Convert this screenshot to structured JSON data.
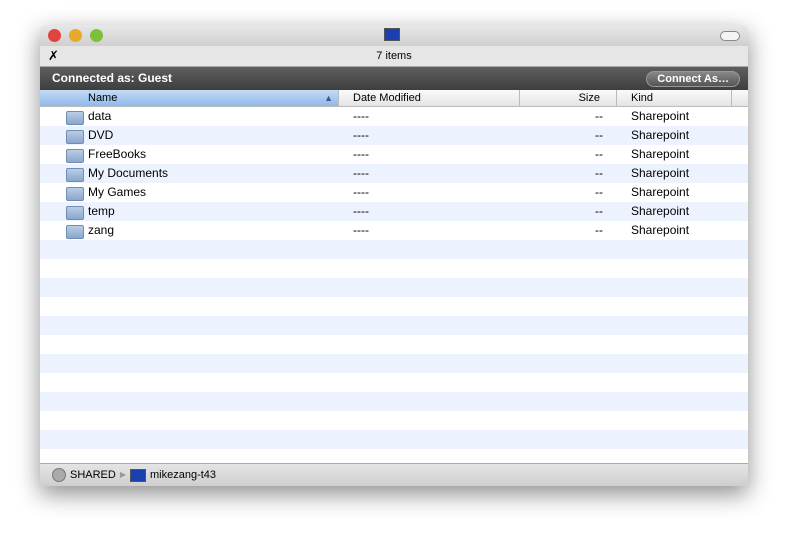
{
  "toolbar": {
    "item_count": "7 items"
  },
  "connection": {
    "label": "Connected as: Guest",
    "button": "Connect As…"
  },
  "columns": [
    "Name",
    "Date Modified",
    "Size",
    "Kind"
  ],
  "rows": [
    {
      "name": "data",
      "date": "----",
      "size": "--",
      "kind": "Sharepoint"
    },
    {
      "name": "DVD",
      "date": "----",
      "size": "--",
      "kind": "Sharepoint"
    },
    {
      "name": "FreeBooks",
      "date": "----",
      "size": "--",
      "kind": "Sharepoint"
    },
    {
      "name": "My Documents",
      "date": "----",
      "size": "--",
      "kind": "Sharepoint"
    },
    {
      "name": "My Games",
      "date": "----",
      "size": "--",
      "kind": "Sharepoint"
    },
    {
      "name": "temp",
      "date": "----",
      "size": "--",
      "kind": "Sharepoint"
    },
    {
      "name": "zang",
      "date": "----",
      "size": "--",
      "kind": "Sharepoint"
    }
  ],
  "path": [
    "SHARED",
    "mikezang-t43"
  ]
}
